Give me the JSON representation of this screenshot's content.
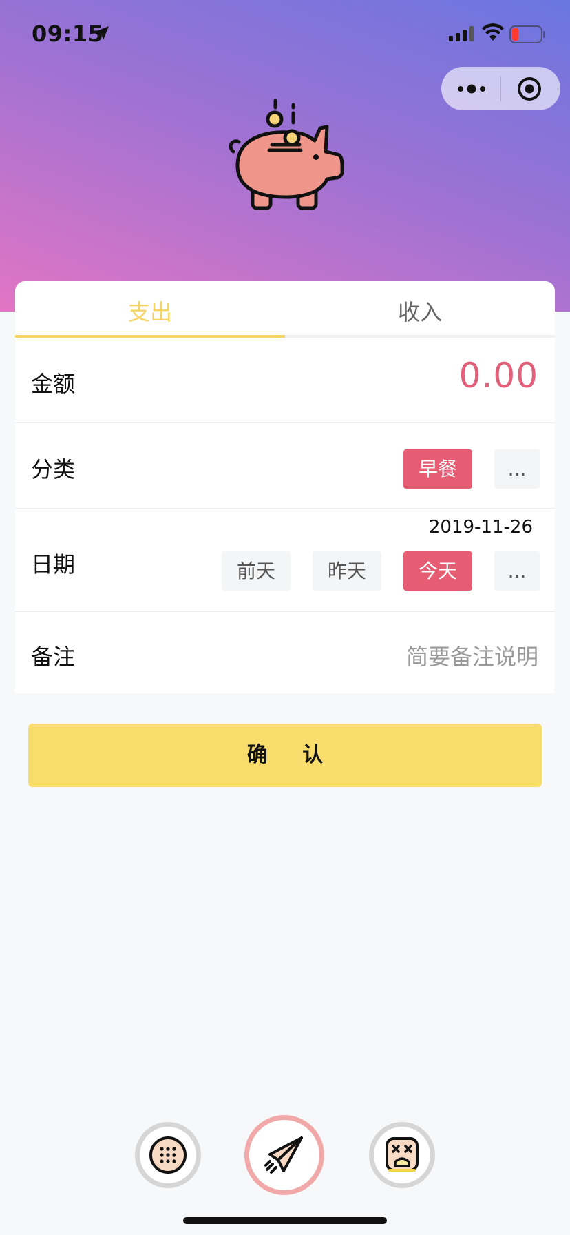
{
  "status_bar": {
    "time": "09:15"
  },
  "tabs": [
    {
      "label": "支出",
      "active": true
    },
    {
      "label": "收入",
      "active": false
    }
  ],
  "form": {
    "amount": {
      "label": "金额",
      "value": "0.00"
    },
    "category": {
      "label": "分类",
      "selected": "早餐",
      "more": "..."
    },
    "date": {
      "label": "日期",
      "value": "2019-11-26",
      "options": [
        "前天",
        "昨天",
        "今天"
      ],
      "selected": "今天",
      "more": "..."
    },
    "note": {
      "label": "备注",
      "placeholder": "简要备注说明"
    }
  },
  "confirm_label": "确 认",
  "colors": {
    "accent_yellow": "#f8dc6c",
    "tab_active": "#f6d463",
    "selected_chip": "#e65d73",
    "amount": "#e3607a",
    "header_gradient": [
      "#6a76e0",
      "#9b72d4",
      "#e275c4"
    ]
  },
  "bottom_nav": {
    "items": [
      {
        "icon": "grid-dots-icon"
      },
      {
        "icon": "paper-plane-icon",
        "active": true
      },
      {
        "icon": "sad-face-icon"
      }
    ]
  }
}
